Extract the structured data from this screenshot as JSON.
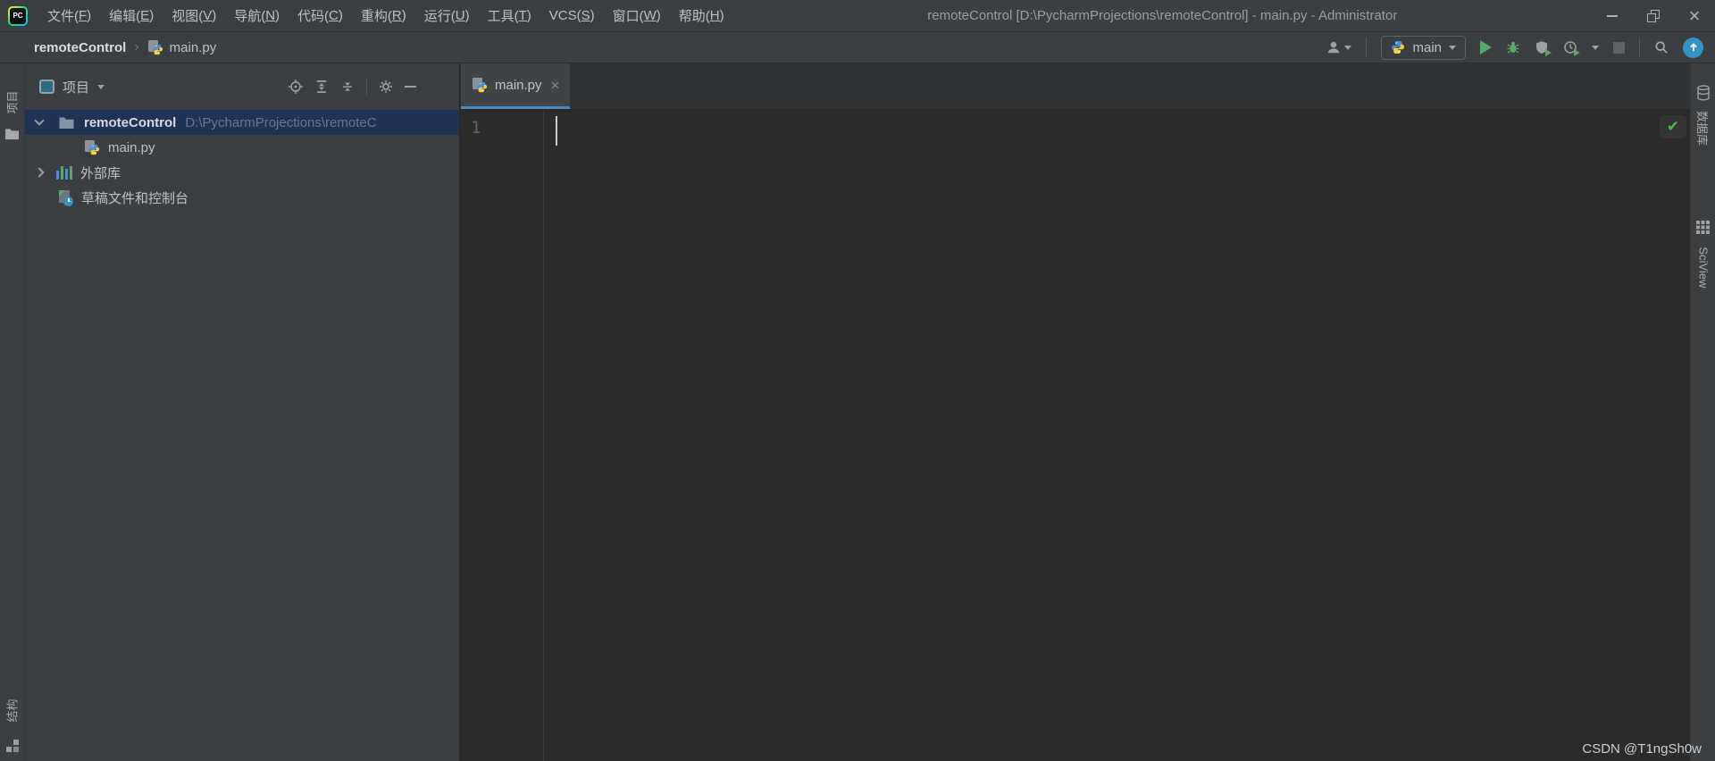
{
  "title_bar": {
    "menus": [
      {
        "pre": "文件(",
        "key": "F",
        "post": ")"
      },
      {
        "pre": "编辑(",
        "key": "E",
        "post": ")"
      },
      {
        "pre": "视图(",
        "key": "V",
        "post": ")"
      },
      {
        "pre": "导航(",
        "key": "N",
        "post": ")"
      },
      {
        "pre": "代码(",
        "key": "C",
        "post": ")"
      },
      {
        "pre": "重构(",
        "key": "R",
        "post": ")"
      },
      {
        "pre": "运行(",
        "key": "U",
        "post": ")"
      },
      {
        "pre": "工具(",
        "key": "T",
        "post": ")"
      },
      {
        "pre": "VCS(",
        "key": "S",
        "post": ")"
      },
      {
        "pre": "窗口(",
        "key": "W",
        "post": ")"
      },
      {
        "pre": "帮助(",
        "key": "H",
        "post": ")"
      }
    ],
    "title": "remoteControl [D:\\PycharmProjections\\remoteControl] - main.py - Administrator",
    "controls": {
      "close": "×"
    }
  },
  "nav_bar": {
    "breadcrumb": {
      "project": "remoteControl",
      "separator": "›",
      "file": "main.py"
    },
    "run_config": {
      "label": "main"
    }
  },
  "project_panel": {
    "header": {
      "title": "项目"
    },
    "tree": {
      "root": {
        "name": "remoteControl",
        "path": "D:\\PycharmProjections\\remoteC"
      },
      "file": {
        "name": "main.py"
      },
      "libraries": {
        "name": "外部库"
      },
      "scratches": {
        "name": "草稿文件和控制台"
      }
    }
  },
  "editor": {
    "tab": {
      "label": "main.py",
      "close_glyph": "×"
    },
    "line_number": "1",
    "inspection_glyph": "✔"
  },
  "stripes": {
    "left_top": "项目",
    "left_bottom": "结构",
    "right_database": "数据库",
    "right_sciview": "SciView"
  },
  "watermark": "CSDN @T1ngSh0w",
  "colors": {
    "bar_background": "#3c3f41",
    "editor_background": "#2b2b2b",
    "tab_accent": "#4a88c7",
    "selection_blue": "#1e3356",
    "run_green": "#59a869",
    "check_green": "#4db54f",
    "update_blue": "#3592c4",
    "python_blue": "#4a90d9",
    "python_yellow": "#f7ce3e"
  }
}
